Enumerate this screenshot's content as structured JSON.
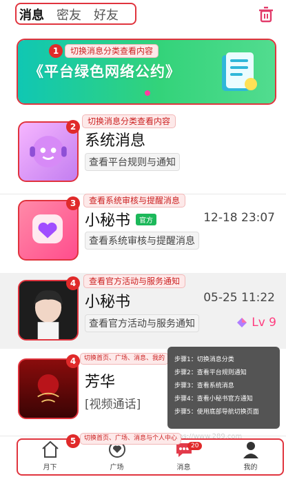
{
  "tabs": [
    {
      "label": "消息",
      "active": true
    },
    {
      "label": "密友",
      "active": false
    },
    {
      "label": "好友",
      "active": false
    }
  ],
  "banner": {
    "title": "《平台绿色网络公约》"
  },
  "messages": [
    {
      "title": "系统消息",
      "subtitle": "查看平台规则与通知",
      "time": "",
      "tag": ""
    },
    {
      "title": "小秘书",
      "subtitle": "查看系统审核与提醒消息",
      "time": "12-18 23:07",
      "tag": "官方"
    },
    {
      "title": "小秘书",
      "subtitle": "查看官方活动与服务通知",
      "time": "05-25 11:22",
      "tag": "",
      "level": "Lv 9"
    },
    {
      "title": "芳华",
      "subtitle": "[视频通话]",
      "time": "",
      "tag": ""
    }
  ],
  "annotations": [
    {
      "num": "1",
      "text": "切换消息分类查看内容"
    },
    {
      "num": "2",
      "text": "切换消息分类查看内容"
    },
    {
      "num": "3",
      "text": "查看系统审核与提醒消息"
    },
    {
      "num": "4",
      "text": "查看官方活动与服务通知"
    },
    {
      "num": "4",
      "text": "切换首页、广场、消息、我的"
    },
    {
      "num": "5",
      "text": "切换首页、广场、消息与个人中心"
    }
  ],
  "steps": [
    "步骤1：切换消息分类",
    "步骤2：查看平台规则通知",
    "步骤3：查看系统消息",
    "步骤4：查看小秘书官方通知",
    "步骤5：使用底部导航切换页面"
  ],
  "nav": [
    {
      "label": "月下",
      "icon": "home-icon"
    },
    {
      "label": "广场",
      "icon": "plaza-icon"
    },
    {
      "label": "消息",
      "icon": "message-icon",
      "badge": "20"
    },
    {
      "label": "我的",
      "icon": "profile-icon"
    }
  ],
  "watermark": "https://www.289.com",
  "colors": {
    "accent": "#e0333d",
    "banner_start": "#10c7b3",
    "banner_end": "#52dc8f",
    "official_green": "#1cb85a",
    "level_pink": "#ff3d7f"
  }
}
